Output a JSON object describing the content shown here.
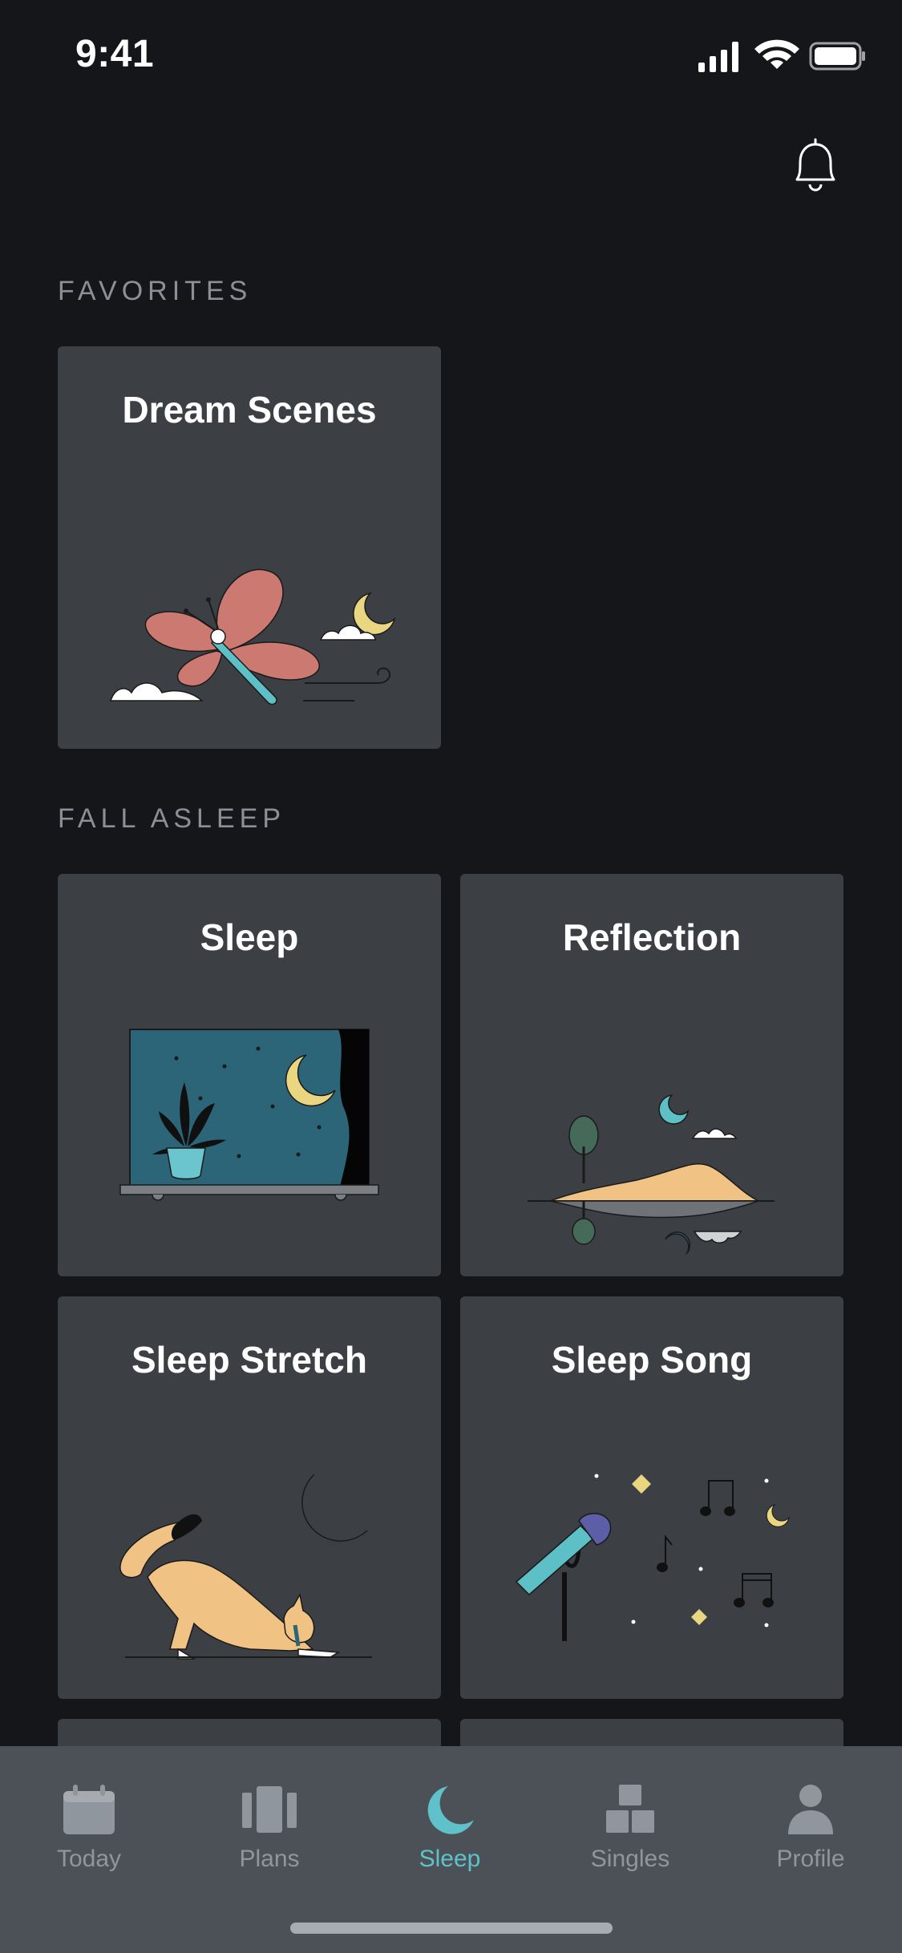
{
  "status_bar": {
    "time": "9:41"
  },
  "sections": {
    "favorites": {
      "title": "FAVORITES",
      "cards": [
        {
          "title": "Dream Scenes",
          "art": "butterfly-clouds-moon"
        }
      ]
    },
    "fall_asleep": {
      "title": "FALL ASLEEP",
      "cards": [
        {
          "title": "Sleep",
          "art": "window-plant-moon"
        },
        {
          "title": "Reflection",
          "art": "island-reflection"
        },
        {
          "title": "Sleep Stretch",
          "art": "cat-stretch-moon"
        },
        {
          "title": "Sleep Song",
          "art": "microphone-music-notes"
        }
      ]
    }
  },
  "tab_bar": {
    "tabs": [
      {
        "label": "Today",
        "icon": "calendar-icon",
        "active": false
      },
      {
        "label": "Plans",
        "icon": "plans-icon",
        "active": false
      },
      {
        "label": "Sleep",
        "icon": "moon-icon",
        "active": true
      },
      {
        "label": "Singles",
        "icon": "blocks-icon",
        "active": false
      },
      {
        "label": "Profile",
        "icon": "person-icon",
        "active": false
      }
    ]
  },
  "colors": {
    "background": "#151619",
    "card": "#3c4045",
    "tab_bar": "#4b5157",
    "accent": "#5fc2ca",
    "inactive": "#8f969d",
    "section_title": "#8c9096"
  }
}
